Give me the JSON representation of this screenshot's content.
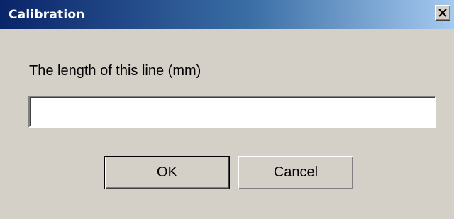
{
  "window": {
    "title": "Calibration",
    "close_icon": "close-icon"
  },
  "form": {
    "prompt": "The length of this line (mm)",
    "length_value": "",
    "length_placeholder": ""
  },
  "buttons": {
    "ok_label": "OK",
    "cancel_label": "Cancel"
  },
  "colors": {
    "titlebar_start": "#0a246a",
    "titlebar_end": "#a6caf0",
    "dialog_background": "#d4d0c8"
  }
}
